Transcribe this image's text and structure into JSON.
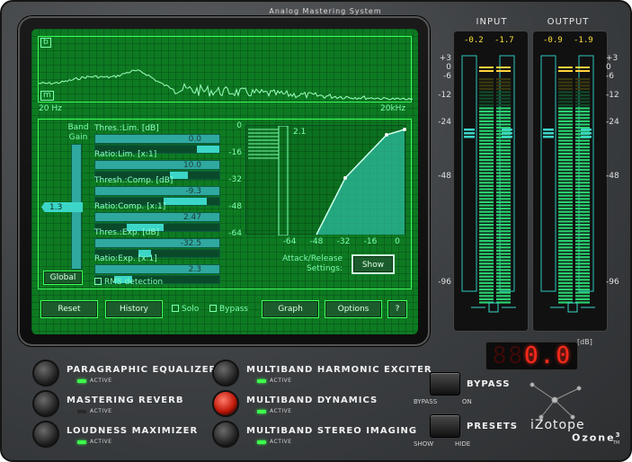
{
  "header": {
    "title": "Analog Mastering System"
  },
  "eq": {
    "band_top": "b",
    "band_bottom": "m",
    "freq_low": "20 Hz",
    "freq_high": "20kHz"
  },
  "dyn": {
    "band_gain_label": "Band Gain",
    "band_gain_value": "1.3",
    "global_label": "Global",
    "params": [
      {
        "label": "Thres.:Lim. [dB]",
        "value": "0.0"
      },
      {
        "label": "Ratio:Lim. [x:1]",
        "value": "10.0"
      },
      {
        "label": "Thresh.:Comp. [dB]",
        "value": "-9.3"
      },
      {
        "label": "Ratio:Comp. [x:1]",
        "value": "2.47"
      },
      {
        "label": "Thres.:Exp. [dB]",
        "value": "-32.5"
      },
      {
        "label": "Ratio:Exp. [x:1]",
        "value": "2.3"
      }
    ],
    "rms_label": "RMS detection",
    "graph_y_ticks": [
      "0",
      "-16",
      "-32",
      "-48",
      "-64"
    ],
    "graph_x_ticks": [
      "-64",
      "-48",
      "-32",
      "-16",
      "0"
    ],
    "graph_ratio_label": "2.1",
    "attack_release_label": "Attack/Release Settings:",
    "show_label": "Show"
  },
  "toolbar": {
    "reset": "Reset",
    "history": "History",
    "solo": "Solo",
    "bypass": "Bypass",
    "graph": "Graph",
    "options": "Options",
    "help": "?"
  },
  "meters": {
    "input_label": "INPUT",
    "output_label": "OUTPUT",
    "input_peaks": [
      "-0.2",
      "-1.7"
    ],
    "output_peaks": [
      "-0.9",
      "-1.9"
    ],
    "left_scale": [
      "+3",
      "0",
      "-6",
      "-12",
      "-24",
      "-48",
      "-96"
    ],
    "right_scale": [
      "+3",
      "0",
      "-6",
      "-12",
      "-24",
      "-48",
      "-96"
    ],
    "db_label": "[dB]",
    "readout": "0.0"
  },
  "modules": [
    {
      "name": "PARAGRAPHIC EQUALIZER",
      "status": "ACTIVE",
      "active": true
    },
    {
      "name": "MASTERING REVERB",
      "status": "ACTIVE",
      "active": false
    },
    {
      "name": "LOUDNESS MAXIMIZER",
      "status": "ACTIVE",
      "active": true
    },
    {
      "name": "MULTIBAND HARMONIC EXCITER",
      "status": "ACTIVE",
      "active": true
    },
    {
      "name": "MULTIBAND DYNAMICS",
      "status": "ACTIVE",
      "active": true
    },
    {
      "name": "MULTIBAND STEREO IMAGING",
      "status": "ACTIVE",
      "active": true
    }
  ],
  "controls": {
    "bypass_label": "BYPASS",
    "bypass_sub_left": "BYPASS",
    "bypass_sub_right": "ON",
    "presets_label": "PRESETS",
    "presets_sub_left": "SHOW",
    "presets_sub_right": "HIDE"
  },
  "brand": {
    "name": "iZotope",
    "product": "Ozone",
    "version": "3",
    "tm": "TM"
  },
  "colors": {
    "screen": "#0d7a22",
    "accent": "#3cff5c",
    "meter": "#3cff9c",
    "led_red": "#ff2a1a"
  }
}
